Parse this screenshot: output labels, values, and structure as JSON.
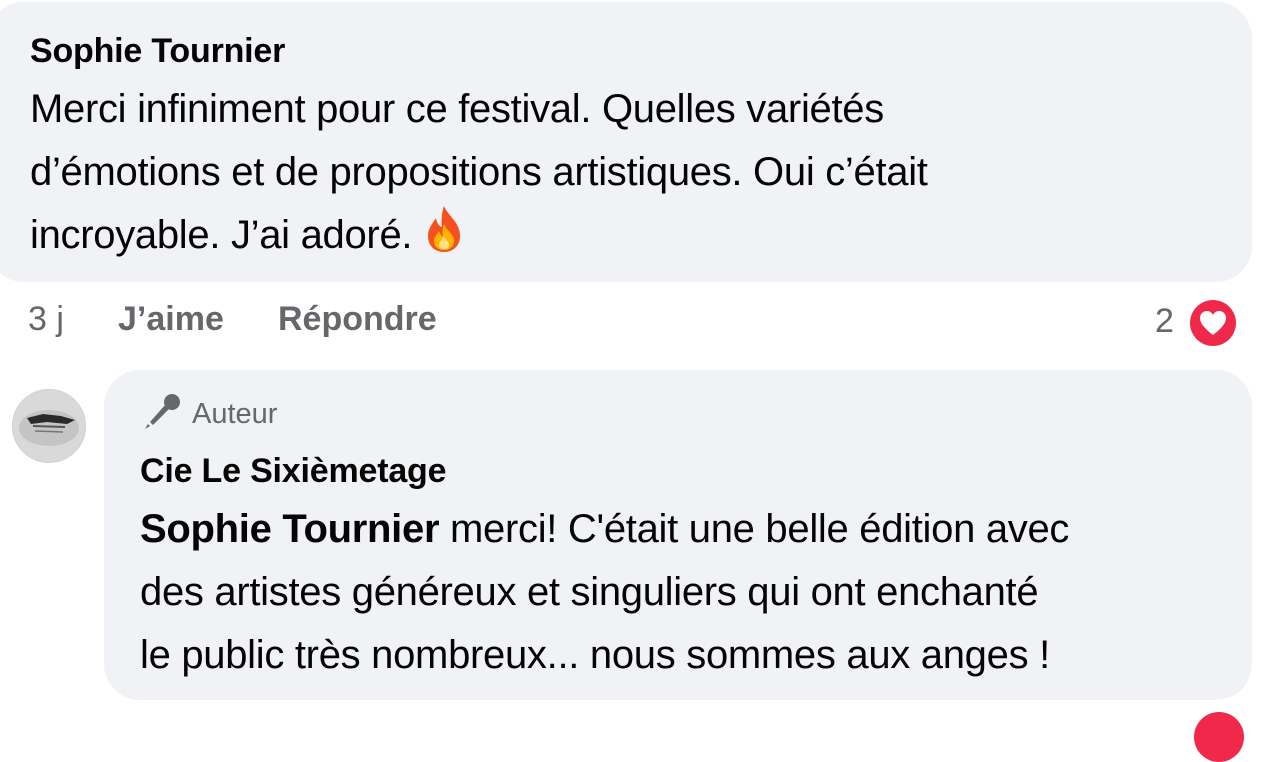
{
  "comment": {
    "author": "Sophie Tournier",
    "lines": [
      "Merci infiniment pour ce festival. Quelles variétés",
      "d’émotions et de propositions artistiques. Oui c’était",
      "incroyable. J’ai adoré."
    ],
    "time": "3 j",
    "like_label": "J’aime",
    "reply_label": "Répondre",
    "reaction_count": "2"
  },
  "reply": {
    "badge": "Auteur",
    "author": "Cie Le Sixièmetage",
    "mention": "Sophie Tournier",
    "lines": [
      " merci! C'était une belle édition avec",
      "des artistes généreux et singuliers qui ont enchanté",
      "le public très nombreux... nous sommes aux anges !"
    ]
  },
  "colors": {
    "bubble_bg": "#f0f2f5",
    "text": "#050505",
    "secondary_text": "#65676b",
    "heart_red": "#f02849"
  },
  "icons": {
    "reaction": "heart-icon",
    "emoji": "fire-emoji-icon",
    "badge": "microphone-icon"
  }
}
